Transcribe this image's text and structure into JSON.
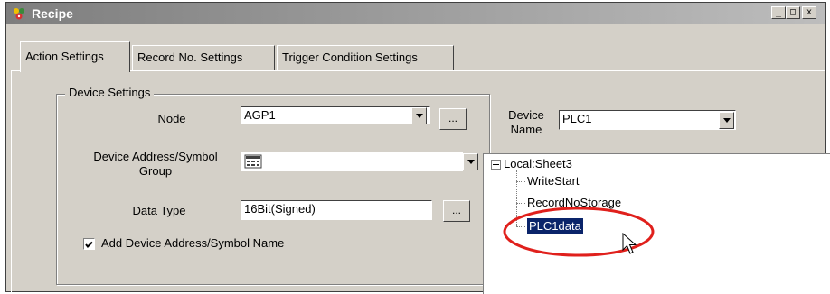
{
  "window": {
    "title": "Recipe",
    "controls": {
      "minimize": "_",
      "maximize": "□",
      "close": "x"
    }
  },
  "tabs": [
    {
      "label": "Action Settings",
      "active": true
    },
    {
      "label": "Record No. Settings",
      "active": false
    },
    {
      "label": "Trigger Condition Settings",
      "active": false
    }
  ],
  "device_settings": {
    "group_title": "Device Settings",
    "node": {
      "label": "Node",
      "value": "AGP1",
      "button": "..."
    },
    "device_name": {
      "label_line1": "Device",
      "label_line2": "Name",
      "value": "PLC1"
    },
    "device_address": {
      "label_line1": "Device Address/Symbol",
      "label_line2": "Group",
      "value": ""
    },
    "data_type": {
      "label": "Data Type",
      "value": "16Bit(Signed)",
      "button": "..."
    },
    "add_symbol": {
      "label": "Add Device Address/Symbol Name",
      "checked": true
    }
  },
  "tree": {
    "root": "Local:Sheet3",
    "expander": "-",
    "items": [
      {
        "label": "WriteStart",
        "selected": false
      },
      {
        "label": "RecordNoStorage",
        "selected": false
      },
      {
        "label": "PLC1data",
        "selected": true
      }
    ]
  },
  "colors": {
    "face": "#d4d0c8",
    "selection": "#0a246a",
    "highlight_ellipse": "#e0201c"
  },
  "icons": [
    "app-recipe-icon",
    "symbol-group-icon",
    "mouse-pointer-icon"
  ]
}
